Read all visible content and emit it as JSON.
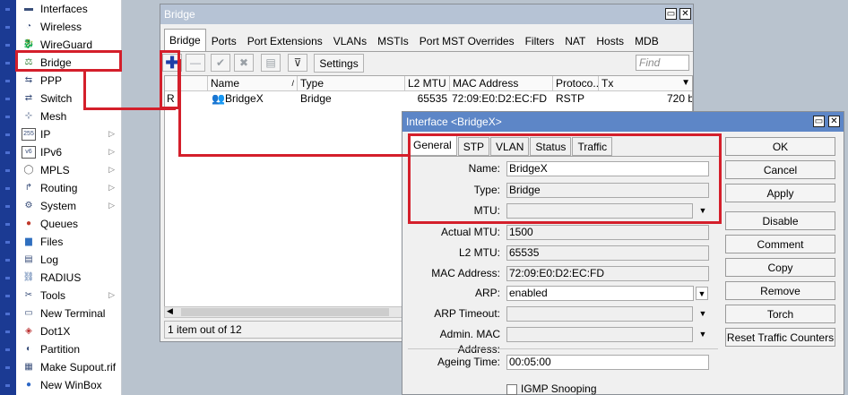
{
  "sidebar": {
    "items": [
      {
        "label": "Interfaces",
        "icon": "interfaces-icon",
        "submenu": false
      },
      {
        "label": "Wireless",
        "icon": "wireless-icon",
        "submenu": false
      },
      {
        "label": "WireGuard",
        "icon": "wireguard-icon",
        "submenu": false
      },
      {
        "label": "Bridge",
        "icon": "bridge-icon",
        "submenu": false
      },
      {
        "label": "PPP",
        "icon": "ppp-icon",
        "submenu": false
      },
      {
        "label": "Switch",
        "icon": "switch-icon",
        "submenu": false
      },
      {
        "label": "Mesh",
        "icon": "mesh-icon",
        "submenu": false
      },
      {
        "label": "IP",
        "icon": "ip-icon",
        "submenu": true
      },
      {
        "label": "IPv6",
        "icon": "ipv6-icon",
        "submenu": true
      },
      {
        "label": "MPLS",
        "icon": "mpls-icon",
        "submenu": true
      },
      {
        "label": "Routing",
        "icon": "routing-icon",
        "submenu": true
      },
      {
        "label": "System",
        "icon": "system-icon",
        "submenu": true
      },
      {
        "label": "Queues",
        "icon": "queues-icon",
        "submenu": false
      },
      {
        "label": "Files",
        "icon": "files-icon",
        "submenu": false
      },
      {
        "label": "Log",
        "icon": "log-icon",
        "submenu": false
      },
      {
        "label": "RADIUS",
        "icon": "radius-icon",
        "submenu": false
      },
      {
        "label": "Tools",
        "icon": "tools-icon",
        "submenu": true
      },
      {
        "label": "New Terminal",
        "icon": "terminal-icon",
        "submenu": false
      },
      {
        "label": "Dot1X",
        "icon": "dot1x-icon",
        "submenu": false
      },
      {
        "label": "Partition",
        "icon": "partition-icon",
        "submenu": false
      },
      {
        "label": "Make Supout.rif",
        "icon": "supout-icon",
        "submenu": false
      },
      {
        "label": "New WinBox",
        "icon": "winbox-icon",
        "submenu": false
      }
    ]
  },
  "bridge_window": {
    "title": "Bridge",
    "tabs": [
      "Bridge",
      "Ports",
      "Port Extensions",
      "VLANs",
      "MSTIs",
      "Port MST Overrides",
      "Filters",
      "NAT",
      "Hosts",
      "MDB"
    ],
    "settings_label": "Settings",
    "find_placeholder": "Find",
    "columns": [
      "Name",
      "Type",
      "L2 MTU",
      "MAC Address",
      "Protoco...",
      "Tx"
    ],
    "rows": [
      {
        "flag": "R",
        "name": "BridgeX",
        "type": "Bridge",
        "l2mtu": "65535",
        "mac": "72:09:E0:D2:EC:FD",
        "protocol": "RSTP",
        "tx": "720 b"
      }
    ],
    "status": "1 item out of 12"
  },
  "interface_dialog": {
    "title": "Interface <BridgeX>",
    "tabs": [
      "General",
      "STP",
      "VLAN",
      "Status",
      "Traffic"
    ],
    "fields": {
      "name_label": "Name:",
      "name_value": "BridgeX",
      "type_label": "Type:",
      "type_value": "Bridge",
      "mtu_label": "MTU:",
      "mtu_value": "",
      "actual_mtu_label": "Actual MTU:",
      "actual_mtu_value": "1500",
      "l2mtu_label": "L2 MTU:",
      "l2mtu_value": "65535",
      "mac_label": "MAC Address:",
      "mac_value": "72:09:E0:D2:EC:FD",
      "arp_label": "ARP:",
      "arp_value": "enabled",
      "arp_timeout_label": "ARP Timeout:",
      "arp_timeout_value": "",
      "admin_mac_label": "Admin. MAC Address:",
      "admin_mac_value": "",
      "ageing_label": "Ageing Time:",
      "ageing_value": "00:05:00",
      "igmp_label": "IGMP Snooping",
      "igmp_checked": false
    },
    "buttons": [
      "OK",
      "Cancel",
      "Apply",
      "Disable",
      "Comment",
      "Copy",
      "Remove",
      "Torch",
      "Reset Traffic Counters"
    ]
  },
  "colors": {
    "highlight": "#d41f2b",
    "add_icon": "#1f3fa8",
    "left_strip": "#1b3a93",
    "titlebar": "#b6c3d5"
  }
}
